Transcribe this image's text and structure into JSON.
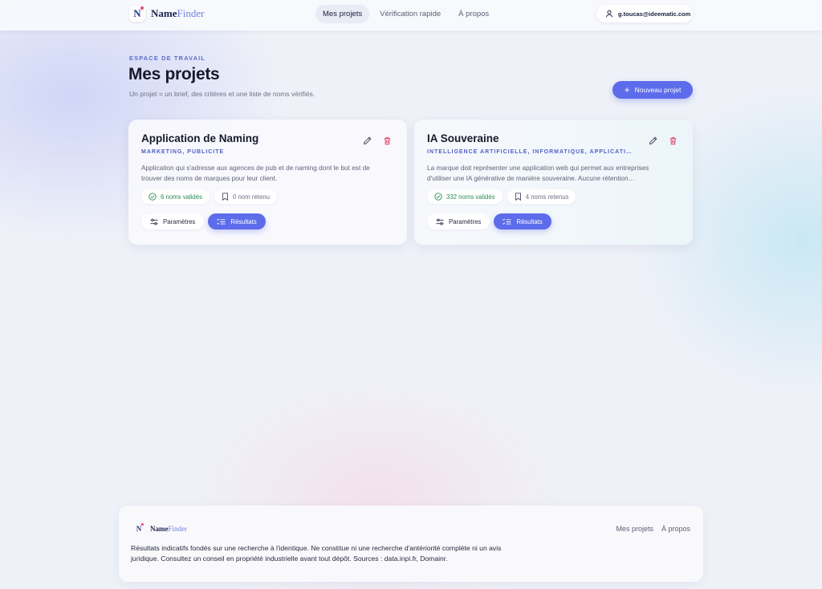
{
  "brand": {
    "name_main": "Name",
    "name_accent": "Finder",
    "mark": "N"
  },
  "nav": {
    "items": [
      {
        "label": "Mes projets",
        "active": true
      },
      {
        "label": "Vérification rapide",
        "active": false
      },
      {
        "label": "À propos",
        "active": false
      }
    ]
  },
  "user": {
    "email": "g.toucas@ideematic.com"
  },
  "page": {
    "eyebrow": "ESPACE DE TRAVAIL",
    "title": "Mes projets",
    "subtitle": "Un projet = un brief, des critères et une liste de noms vérifiés.",
    "new_button": "Nouveau projet"
  },
  "projects": [
    {
      "title": "Application de Naming",
      "tags": "MARKETING, PUBLICITÉ",
      "description": "Application qui s'adresse aux agences de pub et de naming dont le but est de trouver des noms de marques pour leur client.",
      "validated": "6 noms validés",
      "retained": "0 nom retenu",
      "settings_label": "Paramètres",
      "results_label": "Résultats"
    },
    {
      "title": "IA Souveraine",
      "tags": "INTELLIGENCE ARTIFICIELLE, INFORMATIQUE, APPLICATIO…",
      "description": "La marque doit représenter une application web qui permet aux entreprises d'utiliser une IA générative de manière souveraine. Aucune rétention…",
      "validated": "332 noms validés",
      "retained": "4 noms retenus",
      "settings_label": "Paramètres",
      "results_label": "Résultats"
    }
  ],
  "footer": {
    "links": [
      "Mes projets",
      "À propos"
    ],
    "note": "Résultats indicatifs fondés sur une recherche à l'identique. Ne constitue ni une recherche d'antériorité complète ni un avis juridique. Consultez un conseil en propriété industrielle avant tout dépôt. Sources : data.inpi.fr, Domainr."
  },
  "colors": {
    "accent": "#5c6cea",
    "valid": "#2e8b57",
    "danger": "#e0456b",
    "eyebrow": "#5d6bcb"
  },
  "icons": [
    "user-icon",
    "plus-icon",
    "edit-icon",
    "trash-icon",
    "check-circle-icon",
    "bookmark-icon",
    "sliders-icon",
    "list-check-icon"
  ]
}
